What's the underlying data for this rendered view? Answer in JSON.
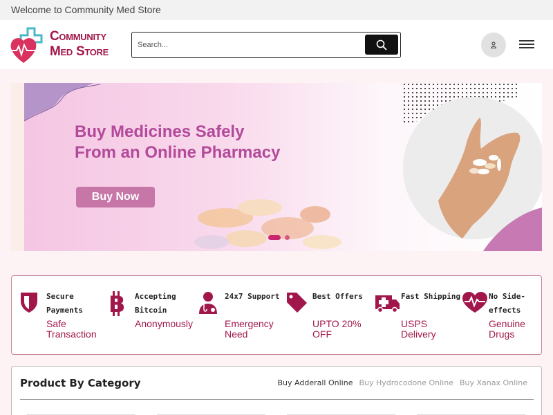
{
  "topbar": {
    "welcome": "Welcome to Community Med Store"
  },
  "header": {
    "logo_line1": "Community",
    "logo_line2": "Med Store",
    "search_placeholder": "Search...",
    "search_icon": "search-icon",
    "user_icon": "user-icon",
    "menu_icon": "hamburger-menu-icon"
  },
  "banner": {
    "title_line1": "Buy Medicines Safely",
    "title_line2": "From an Online Pharmacy",
    "button": "Buy Now",
    "slides": 2,
    "active_slide": 1
  },
  "features": [
    {
      "title": "Secure Payments",
      "subtitle": "Safe Transaction",
      "icon": "shield-icon"
    },
    {
      "title": "Accepting Bitcoin",
      "subtitle": "Anonymously",
      "icon": "bitcoin-icon"
    },
    {
      "title": "24x7 Support",
      "subtitle": "Emergency Need",
      "icon": "doctor-icon"
    },
    {
      "title": "Best Offers",
      "subtitle": "UPTO 20% OFF",
      "icon": "tag-icon"
    },
    {
      "title": "Fast Shipping",
      "subtitle": "USPS Delivery",
      "icon": "ambulance-icon"
    },
    {
      "title": "No Side-effects",
      "subtitle": "Genuine Drugs",
      "icon": "heart-pulse-icon"
    }
  ],
  "category": {
    "title": "Product By Category",
    "tabs": [
      "Buy Adderall Online",
      "Buy Hydrocodone Online",
      "Buy Xanax Online"
    ],
    "active_tab": "Buy Adderall Online"
  },
  "colors": {
    "brand": "#a2174b",
    "accent_pink": "#c9286f",
    "banner_text": "#b3499a"
  }
}
